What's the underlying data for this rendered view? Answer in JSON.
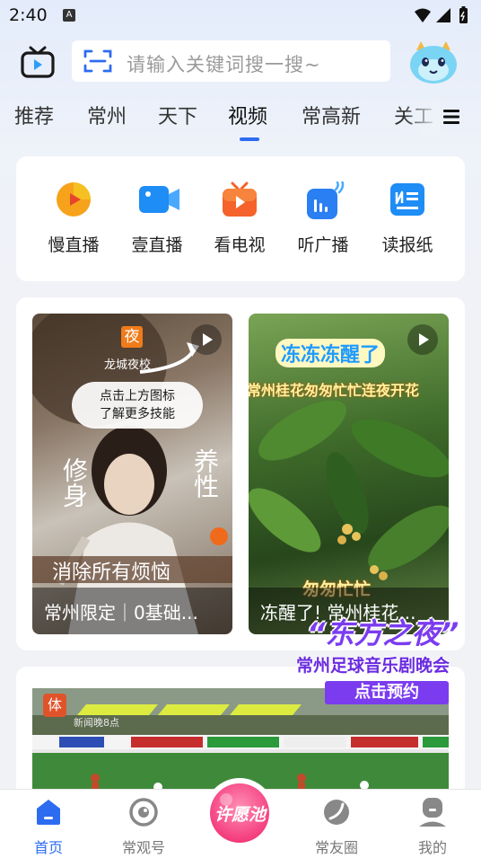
{
  "status_bar": {
    "time": "2:40",
    "notification_glyph": "A"
  },
  "header": {
    "search_placeholder": "请输入关键词搜一搜~",
    "icons": [
      "tv-icon",
      "scan-icon",
      "mascot-avatar"
    ]
  },
  "tabs": [
    {
      "label": "推荐",
      "active": false
    },
    {
      "label": "常州",
      "active": false
    },
    {
      "label": "天下",
      "active": false
    },
    {
      "label": "视频",
      "active": true
    },
    {
      "label": "常高新",
      "active": false
    },
    {
      "label": "关工",
      "active": false
    }
  ],
  "quick_links": [
    {
      "label": "慢直播",
      "icon": "slow-live-icon",
      "color": "#f7a21b"
    },
    {
      "label": "壹直播",
      "icon": "live-camera-icon",
      "color": "#1e8df5"
    },
    {
      "label": "看电视",
      "icon": "tv-play-icon",
      "color": "#f5622b"
    },
    {
      "label": "听广播",
      "icon": "radio-icon",
      "color": "#2a7ff3"
    },
    {
      "label": "读报纸",
      "icon": "newspaper-icon",
      "color": "#1e8df5"
    }
  ],
  "videos": [
    {
      "caption": "常州限定｜0基础...",
      "overlay": {
        "badge": "夜",
        "school": "龙城夜校",
        "bubble": "点击上方图标\n了解更多技能",
        "left": "修身",
        "right": "养性",
        "bottom": "消除所有烦恼"
      }
    },
    {
      "caption": "冻醒了! 常州桂花...",
      "overlay": {
        "headline": "冻冻冻醒了",
        "subline": "常州桂花匆匆忙忙连夜开花",
        "tag": "匆匆忙忙"
      }
    }
  ],
  "promo": {
    "title": "“东方之夜”",
    "subtitle": "常州足球音乐剧晚会",
    "button": "点击预约"
  },
  "live_thumb": {
    "tag": "体",
    "source": "新闻晚8点"
  },
  "tab_bar": [
    {
      "label": "首页",
      "icon": "home-icon",
      "active": true
    },
    {
      "label": "常观号",
      "icon": "eye-icon",
      "active": false
    },
    {
      "label": "许愿池",
      "icon": "wish-pool-icon",
      "active": false
    },
    {
      "label": "常友圈",
      "icon": "friend-circle-icon",
      "active": false
    },
    {
      "label": "我的",
      "icon": "profile-icon",
      "active": false
    }
  ],
  "colors": {
    "accent": "#2d6cf0",
    "placeholder": "#9a9a9a"
  }
}
